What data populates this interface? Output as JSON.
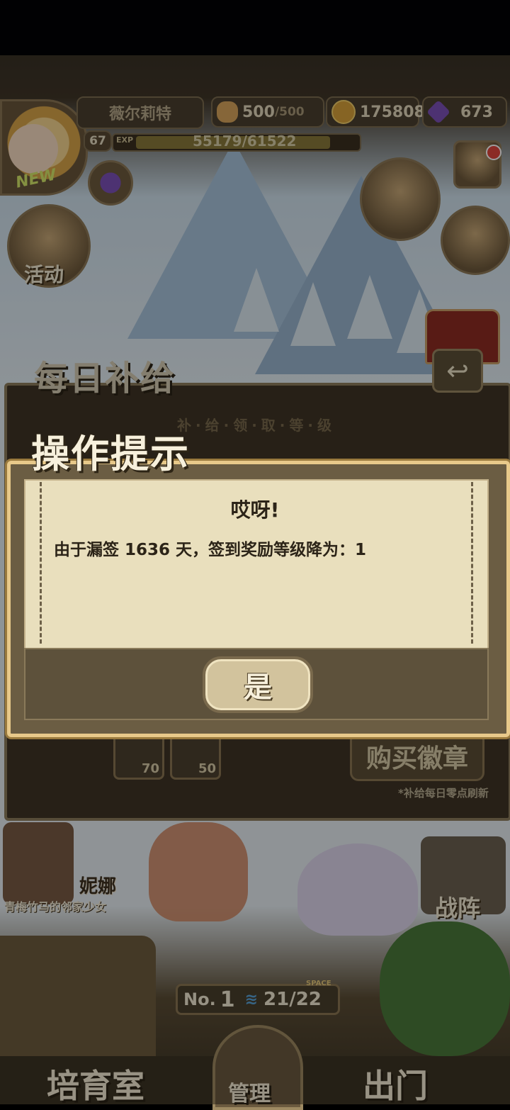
{
  "hud": {
    "player_name": "薇尔莉特",
    "level": "67",
    "exp_label": "EXP",
    "exp_text": "55179/61522",
    "exp_progress": 0.8969,
    "stamina": "500",
    "stamina_max": "/500",
    "gold": "175808",
    "gems": "673",
    "new_badge": "NEW"
  },
  "side_buttons": {
    "activity_label": "活动"
  },
  "daily_panel": {
    "title": "每日补给",
    "subtitle": "补·给·领·取·等·级",
    "reward_gem_count": "70",
    "reward_bread_count": "50",
    "buy_badge_label": "购买徽章",
    "refresh_note": "*补给每日零点刷新"
  },
  "modal": {
    "title": "操作提示",
    "heading": "哎呀!",
    "message": "由于漏签 1636 天，签到奖励等级降为：1",
    "confirm_label": "是"
  },
  "scene": {
    "npc_name": "妮娜",
    "npc_desc": "青梅竹马的邻家少女",
    "formation_label": "战阵",
    "rank_no": "No.",
    "rank_num": "1",
    "space_label": "SPACE",
    "space_count": "21/22"
  },
  "nav": {
    "nursery": "培育室",
    "manage": "管理",
    "go_out": "出门"
  },
  "colors": {
    "panel_bg": "#3f3526",
    "modal_paper": "#e9dfbd",
    "modal_border": "#e8c98a",
    "gem_purple": "#7d52b8",
    "gold_coin": "#d9a23a",
    "bread": "#d8a55c"
  },
  "icons": {
    "stamina": "bread-icon",
    "gold": "coin-icon",
    "gems": "gem-icon",
    "mail": "mail-icon",
    "back": "back-arrow-icon"
  }
}
